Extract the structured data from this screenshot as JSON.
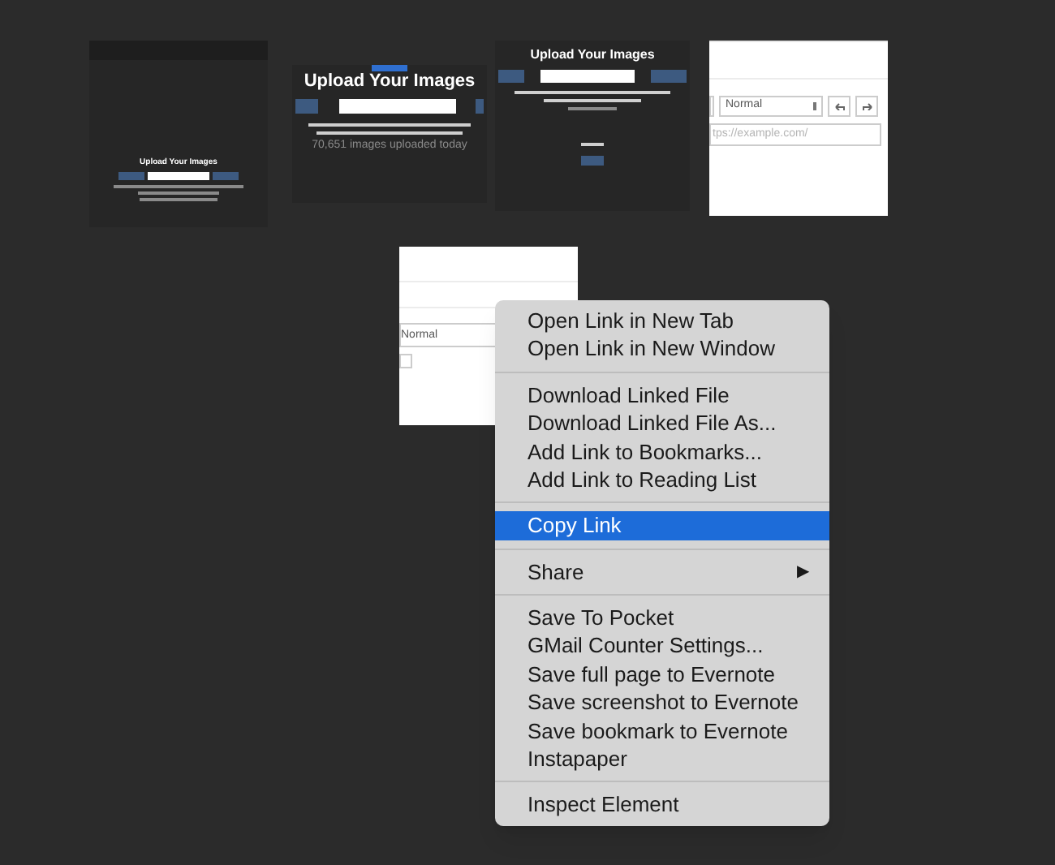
{
  "thumbnails": [
    {
      "kind": "dark-site",
      "title": "Upload Your Images"
    },
    {
      "kind": "dark-upload",
      "title": "Upload Your Images",
      "counter": "70,651 images uploaded today"
    },
    {
      "kind": "dark-upload-small",
      "title": "Upload Your Images"
    },
    {
      "kind": "editor",
      "select": "Normal",
      "url": "tps://example.com/"
    },
    {
      "kind": "editor-small",
      "select": "Normal"
    }
  ],
  "context_menu": {
    "groups": [
      [
        {
          "label": "Open Link in New Tab",
          "selected": false
        },
        {
          "label": "Open Link in New Window",
          "selected": false
        }
      ],
      [
        {
          "label": "Download Linked File",
          "selected": false
        },
        {
          "label": "Download Linked File As...",
          "selected": false
        },
        {
          "label": "Add Link to Bookmarks...",
          "selected": false
        },
        {
          "label": "Add Link to Reading List",
          "selected": false
        }
      ],
      [
        {
          "label": "Copy Link",
          "selected": true
        }
      ],
      [
        {
          "label": "Share",
          "selected": false,
          "submenu": "▶"
        }
      ],
      [
        {
          "label": "Save To Pocket",
          "selected": false
        },
        {
          "label": "GMail Counter Settings...",
          "selected": false
        },
        {
          "label": "Save full page to Evernote",
          "selected": false
        },
        {
          "label": "Save screenshot to Evernote",
          "selected": false
        },
        {
          "label": "Save bookmark to Evernote",
          "selected": false
        },
        {
          "label": "Instapaper",
          "selected": false
        }
      ],
      [
        {
          "label": "Inspect Element",
          "selected": false
        }
      ]
    ]
  }
}
